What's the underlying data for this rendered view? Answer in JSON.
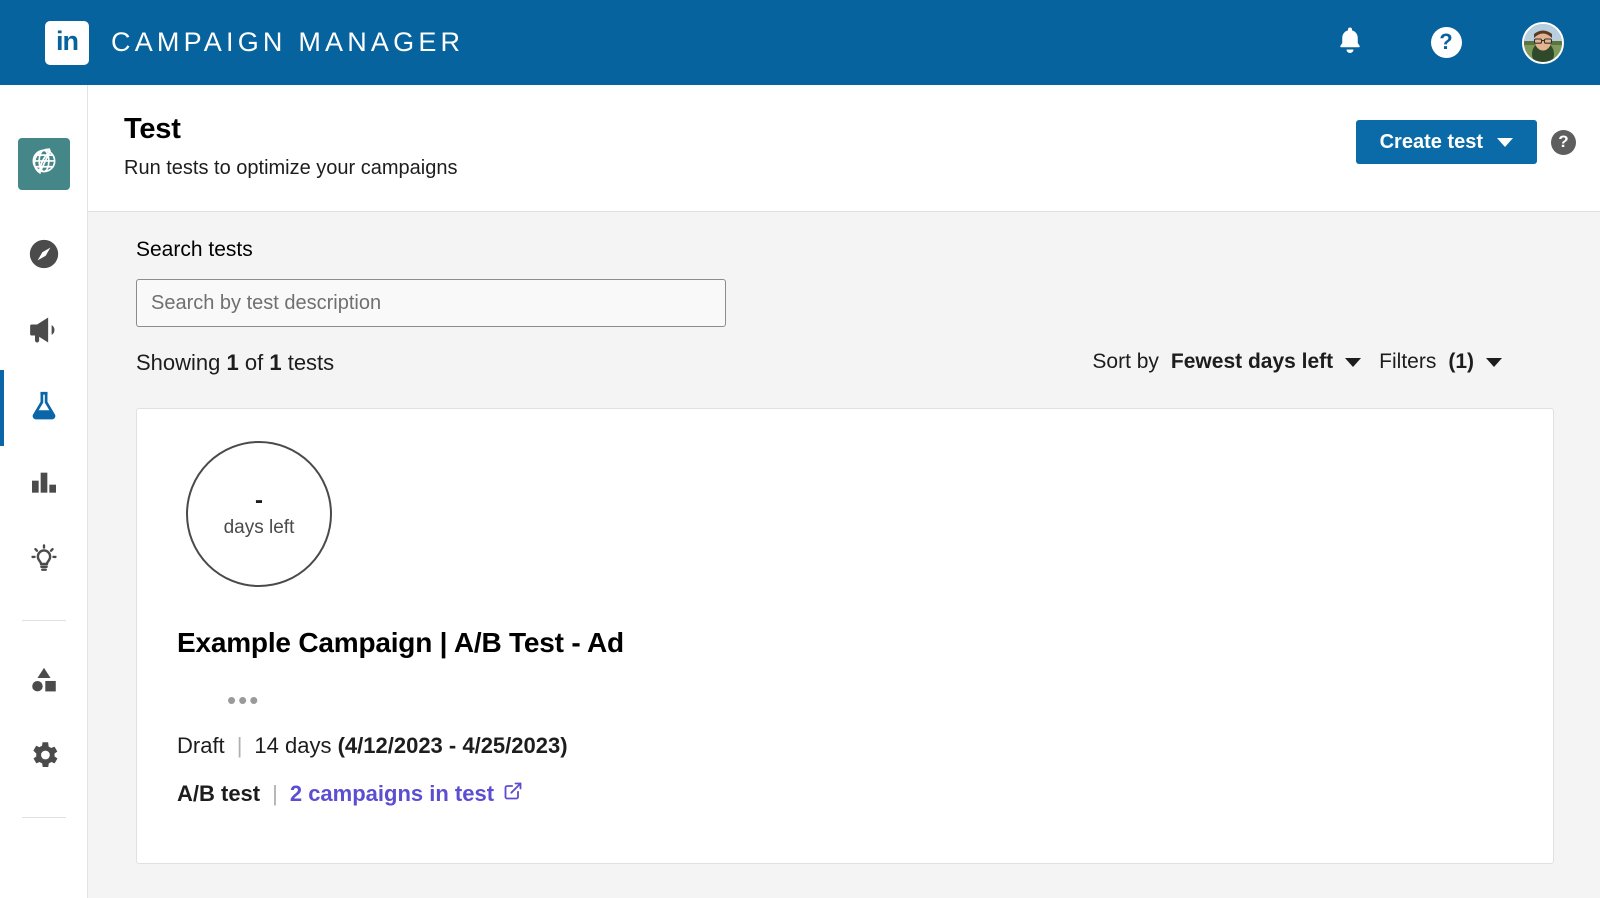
{
  "topbar": {
    "logo_text": "in",
    "logo_name": "linkedin-logo",
    "title": "CAMPAIGN MANAGER",
    "notifications_icon": "bell-icon",
    "help_icon": "question-mark-icon",
    "help_glyph": "?",
    "avatar_name": "user-avatar",
    "background_color": "#06639e"
  },
  "rail": {
    "logo_tile": {
      "name": "account-logo-tile",
      "color": "#458688",
      "icon": "globe-leaf-icon"
    },
    "items": [
      {
        "name": "sidebar-item-plan",
        "icon": "compass-icon",
        "active": false
      },
      {
        "name": "sidebar-item-advertise",
        "icon": "megaphone-icon",
        "active": false
      },
      {
        "name": "sidebar-item-test",
        "icon": "beaker-icon",
        "active": true
      },
      {
        "name": "sidebar-item-analyze",
        "icon": "bar-chart-icon",
        "active": false
      },
      {
        "name": "sidebar-item-insights",
        "icon": "lightbulb-icon",
        "active": false
      },
      {
        "name": "sidebar-item-assets",
        "icon": "shapes-icon",
        "active": false
      },
      {
        "name": "sidebar-item-settings",
        "icon": "gear-icon",
        "active": false
      }
    ],
    "active_color": "#0a66a8"
  },
  "page": {
    "title": "Test",
    "subtitle": "Run tests to optimize your campaigns",
    "create_button_label": "Create test",
    "create_button_color": "#0a6ba8",
    "help_glyph": "?"
  },
  "search": {
    "label": "Search tests",
    "placeholder": "Search by test description",
    "value": ""
  },
  "results": {
    "showing_prefix": "Showing ",
    "showing_count": "1",
    "showing_middle": " of ",
    "showing_total": "1",
    "showing_suffix": " tests",
    "sort_prefix": "Sort by ",
    "sort_value": "Fewest days left",
    "filters_label": "Filters",
    "filters_count": "(1)"
  },
  "test_card": {
    "days_value": "-",
    "days_label": "days left",
    "title": "Example Campaign | A/B Test - Ad",
    "ellipsis": "•••",
    "status": "Draft",
    "separator": "|",
    "duration": "14 days",
    "date_range": "(4/12/2023 - 4/25/2023)",
    "test_type": "A/B test",
    "campaigns_link": "2 campaigns in test",
    "external_link_icon": "external-link-icon",
    "link_color": "#5c4ed1"
  }
}
